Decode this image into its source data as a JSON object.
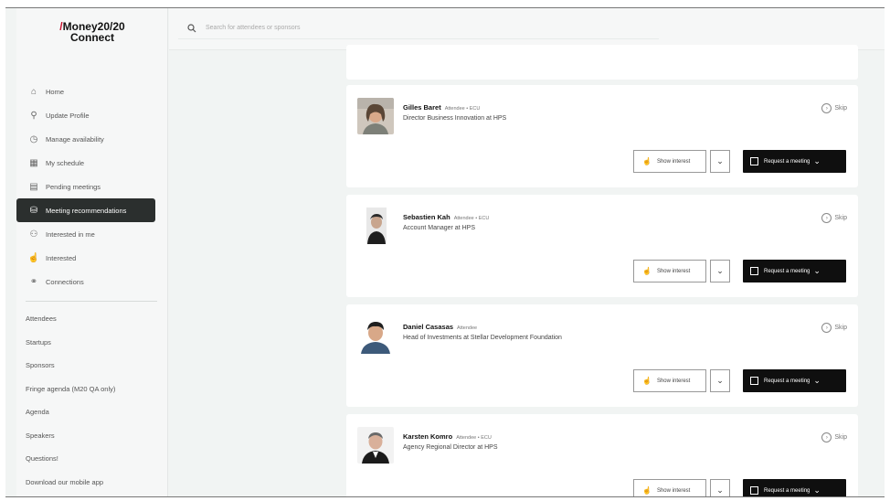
{
  "app": {
    "logo_line1": "/Money20/20",
    "logo_line2": "Connect"
  },
  "search": {
    "placeholder": "Search for attendees or sponsors"
  },
  "sidebar": {
    "nav": [
      {
        "label": "Home",
        "icon": "home-icon",
        "glyph": "⌂"
      },
      {
        "label": "Update Profile",
        "icon": "profile-icon",
        "glyph": "⚲"
      },
      {
        "label": "Manage availability",
        "icon": "clock-icon",
        "glyph": "◷"
      },
      {
        "label": "My schedule",
        "icon": "calendar-icon",
        "glyph": "▦"
      },
      {
        "label": "Pending meetings",
        "icon": "pending-calendar-icon",
        "glyph": "▤"
      },
      {
        "label": "Meeting recommendations",
        "icon": "recommendations-icon",
        "glyph": "⛁",
        "active": true
      },
      {
        "label": "Interested in me",
        "icon": "interested-in-me-icon",
        "glyph": "⚇"
      },
      {
        "label": "Interested",
        "icon": "thumbs-up-icon",
        "glyph": "☝"
      },
      {
        "label": "Connections",
        "icon": "connections-icon",
        "glyph": "⚭"
      }
    ],
    "links": [
      "Attendees",
      "Startups",
      "Sponsors",
      "Fringe agenda (M20 QA only)",
      "Agenda",
      "Speakers",
      "Questions!",
      "Download our mobile app"
    ]
  },
  "actions": {
    "skip": "Skip",
    "show_interest": "Show interest",
    "request_meeting": "Request a meeting"
  },
  "people": [
    {
      "name": "Gilles Baret",
      "tag": "Attendee • ECU",
      "title": "Director Business Innovation at HPS"
    },
    {
      "name": "Sebastien Kah",
      "tag": "Attendee • ECU",
      "title": "Account Manager at HPS"
    },
    {
      "name": "Daniel Casasas",
      "tag": "Attendee",
      "title": "Head of Investments at Stellar Development Foundation"
    },
    {
      "name": "Karsten Komro",
      "tag": "Attendee • ECU",
      "title": "Agency Regional Director at HPS"
    }
  ],
  "colors": {
    "active_nav_bg": "#2b2f2e",
    "request_button_bg": "#0f0f0f",
    "brand_red": "#c8102e",
    "page_bg": "#f1f4f3"
  }
}
